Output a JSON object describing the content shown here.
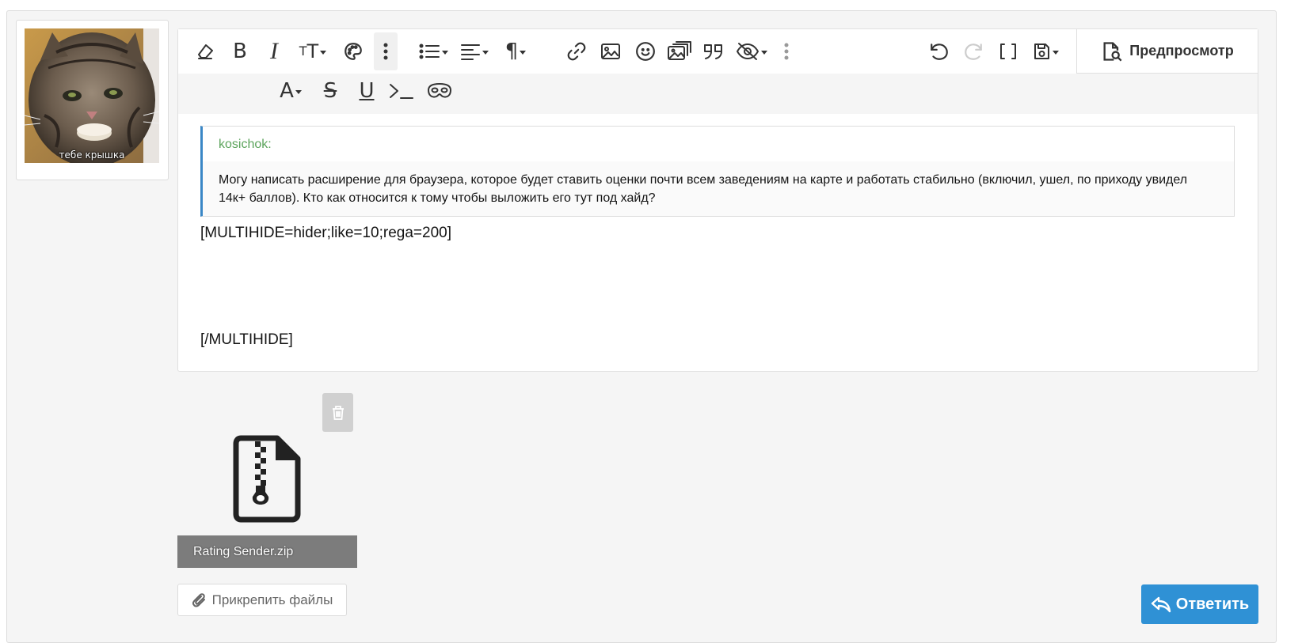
{
  "avatar": {
    "caption": "тебе крышка"
  },
  "toolbar": {
    "preview_label": "Предпросмотр",
    "row1_icons": [
      "eraser-icon",
      "bold-icon",
      "italic-icon",
      "font-size-icon",
      "palette-icon",
      "more-vertical-icon",
      "list-icon",
      "align-icon",
      "paragraph-icon",
      "link-icon",
      "image-icon",
      "emoji-icon",
      "media-icon",
      "quote-icon",
      "hide-icon",
      "more-vertical-icon",
      "undo-icon",
      "redo-icon",
      "brackets-icon",
      "save-draft-icon"
    ],
    "row2_icons": [
      "text-color-icon",
      "strikethrough-icon",
      "underline-icon",
      "code-icon",
      "mask-icon"
    ]
  },
  "quote": {
    "author": "kosichok:",
    "text": "Могу написать расширение для браузера, которое будет ставить оценки почти всем заведениям на карте и работать стабильно (включил, ушел, по приходу увидел 14к+ баллов). Кто как относится к тому чтобы выложить его тут под хайд?"
  },
  "editor": {
    "open_tag": "[MULTIHIDE=hider;like=10;rega=200]",
    "close_tag": "[/MULTIHIDE]"
  },
  "attachment": {
    "filename": "Rating Sender.zip"
  },
  "buttons": {
    "attach_files": "Прикрепить файлы",
    "reply": "Ответить"
  },
  "colors": {
    "accent": "#2f91d5",
    "quote_border": "#3a87c6",
    "quote_author": "#5ca45c"
  }
}
